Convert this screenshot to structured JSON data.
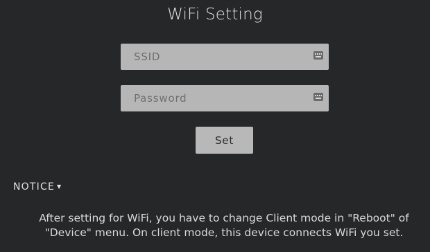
{
  "page": {
    "title": "WiFi Setting"
  },
  "form": {
    "ssid_placeholder": "SSID",
    "ssid_value": "",
    "password_placeholder": "Password",
    "password_value": "",
    "set_label": "Set",
    "field_icon": "keyboard-icon"
  },
  "notice": {
    "label": "NOTICE",
    "caret": "▼",
    "line1": "After setting for WiFi, you have to change Client mode in \"Reboot\" of",
    "line2": "\"Device\" menu. On client mode, this device connects WiFi you set."
  },
  "colors": {
    "background": "#252728",
    "field": "#b6b6b6",
    "button": "#b8b8b8"
  }
}
